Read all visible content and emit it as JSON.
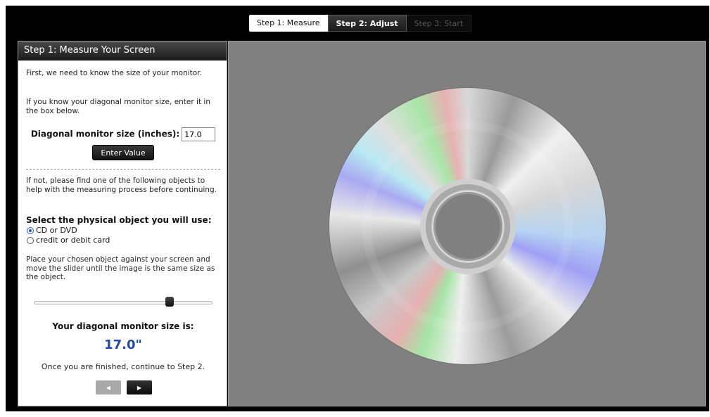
{
  "tabs": [
    {
      "label": "Step 1: Measure",
      "state": "active-white"
    },
    {
      "label": "Step 2: Adjust",
      "state": "current"
    },
    {
      "label": "Step 3: Start",
      "state": "disabled"
    }
  ],
  "sidebar": {
    "title": "Step 1: Measure Your Screen",
    "intro": "First, we need to know the size of your monitor.",
    "known_text": "If you know your diagonal monitor size, enter it in the box below.",
    "diag_label": "Diagonal monitor size (inches):",
    "diag_value": "17.0",
    "enter_button": "Enter Value",
    "ifnot_text": "If not, please find one of the following objects to help with the measuring process before continuing.",
    "select_label": "Select the physical object you will use:",
    "options": [
      {
        "label": "CD or DVD",
        "selected": true
      },
      {
        "label": "credit or debit card",
        "selected": false
      }
    ],
    "place_text": "Place your chosen object against your screen and move the slider until the image is the same size as the object.",
    "slider_value": 0.76,
    "result_label": "Your diagonal monitor size is:",
    "result_value": "17.0\"",
    "finish_text": "Once you are finished, continue to Step 2.",
    "prev_icon": "arrow-left-icon",
    "next_icon": "arrow-right-icon"
  },
  "display": {
    "object": "cd-disc-image",
    "background": "#808080"
  },
  "colors": {
    "accent_blue": "#2149b0",
    "header_dark": "#1c1c1c"
  }
}
